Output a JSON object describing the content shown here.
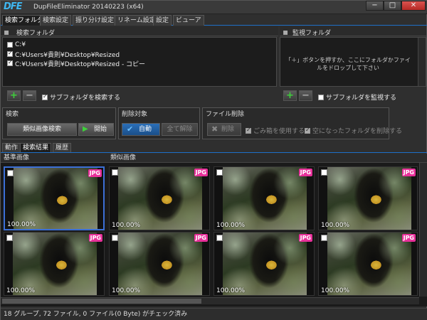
{
  "window": {
    "logo": "DFE",
    "title": "DupFileEliminator 20140223 (x64)",
    "controls": {
      "minimize": "−",
      "maximize": "□",
      "close": "✕"
    }
  },
  "main_tabs": [
    "検索フォルダ",
    "検索設定",
    "振り分け設定",
    "リネーム設定",
    "設定",
    "ビューア"
  ],
  "search_folders": {
    "header": "検索フォルダ",
    "items": [
      {
        "checked": false,
        "path": "C:¥"
      },
      {
        "checked": true,
        "path": "C:¥Users¥貴則¥Desktop¥Resized"
      },
      {
        "checked": true,
        "path": "C:¥Users¥貴則¥Desktop¥Resized - コピー"
      }
    ],
    "add_label": "+",
    "remove_label": "−",
    "subfolder_label": "サブフォルダを検索する",
    "subfolder_checked": true
  },
  "watch_folders": {
    "header": "監視フォルダ",
    "hint": "「＋」ボタンを押すか、ここにフォルダかファイルをドロップして下さい",
    "add_label": "+",
    "remove_label": "−",
    "subfolder_label": "サブフォルダを監視する",
    "subfolder_checked": false
  },
  "search_group": {
    "title": "検索",
    "similar_button": "類似画像検索",
    "start_button": "開始"
  },
  "delete_target_group": {
    "title": "削除対象",
    "auto_button": "自動",
    "clear_all_button": "全て解除"
  },
  "file_delete_group": {
    "title": "ファイル削除",
    "delete_button": "削除",
    "recycle_label": "ごみ箱を使用する",
    "empty_folder_label": "空になったフォルダを削除する"
  },
  "sub_tabs": [
    "動作",
    "検索結果",
    "履歴"
  ],
  "grid": {
    "base_header": "基準画像",
    "similar_header": "類似画像",
    "badge": "JPG",
    "rows": [
      {
        "cells": [
          {
            "pct": "100.00%",
            "selected": true
          },
          {
            "pct": "100.00%"
          },
          {
            "pct": "100.00%"
          },
          {
            "pct": "100.00%"
          }
        ]
      },
      {
        "cells": [
          {
            "pct": "100.00%"
          },
          {
            "pct": "100.00%"
          },
          {
            "pct": "100.00%"
          },
          {
            "pct": "100.00%"
          }
        ]
      }
    ]
  },
  "status": "18 グループ, 72 ファイル, 0 ファイル(0 Byte) がチェック済み"
}
